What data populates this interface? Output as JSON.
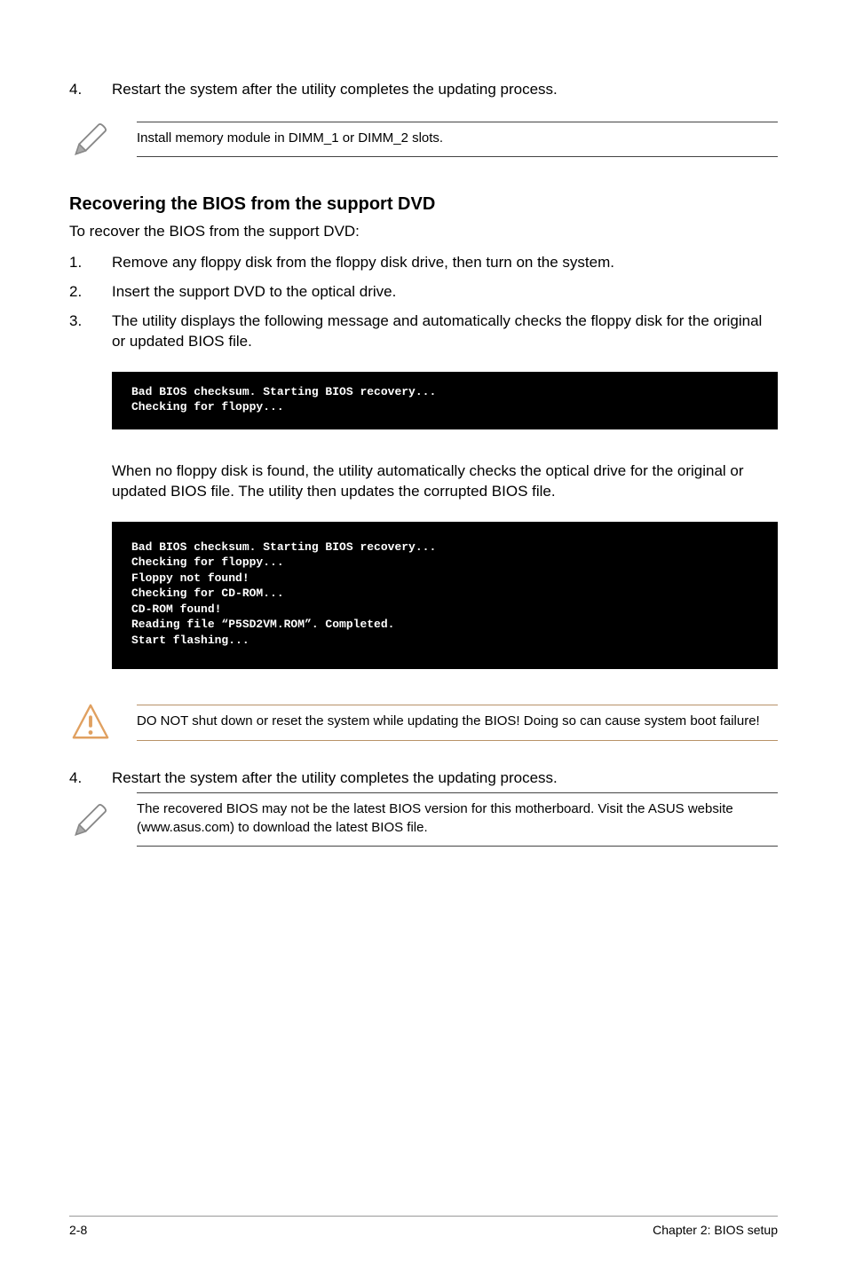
{
  "step4_top": {
    "num": "4.",
    "text": "Restart the system after the utility completes the updating process."
  },
  "note1": "Install memory module in DIMM_1 or DIMM_2 slots.",
  "heading": "Recovering the BIOS from the support DVD",
  "intro": "To recover the BIOS from the support DVD:",
  "steps": [
    {
      "num": "1.",
      "text": "Remove any floppy disk from the floppy disk drive, then turn on the system."
    },
    {
      "num": "2.",
      "text": "Insert the support DVD to the optical drive."
    },
    {
      "num": "3.",
      "text": "The utility displays the following message and automatically checks the floppy disk for the original or updated BIOS file."
    }
  ],
  "terminal1": "Bad BIOS checksum. Starting BIOS recovery...\nChecking for floppy...",
  "mid_para": "When no floppy disk is found, the utility automatically checks the optical drive for the original or updated BIOS file. The utility then updates the corrupted BIOS file.",
  "terminal2": "Bad BIOS checksum. Starting BIOS recovery...\nChecking for floppy...\nFloppy not found!\nChecking for CD-ROM...\nCD-ROM found!\nReading file “P5SD2VM.ROM”. Completed.\nStart flashing...",
  "warn": "DO NOT shut down or reset the system while updating the BIOS! Doing so can cause system boot failure!",
  "step4_bottom": {
    "num": "4.",
    "text": "Restart the system after the utility completes the updating process."
  },
  "note2": "The recovered BIOS may not be the latest BIOS version for this motherboard. Visit the ASUS website (www.asus.com) to download the latest BIOS file.",
  "footer": {
    "left": "2-8",
    "right": "Chapter 2: BIOS setup"
  }
}
